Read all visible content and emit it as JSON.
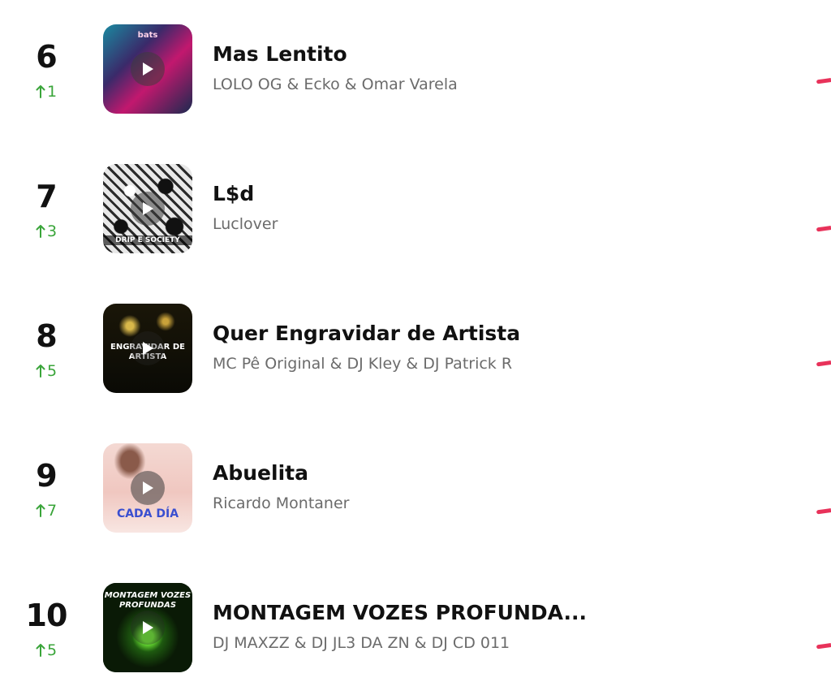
{
  "colors": {
    "rank_up": "#3aa53a",
    "title": "#111111",
    "artist": "#6b6b6b",
    "trend_line": "#e8325a"
  },
  "icons": {
    "rank_change": "arrow-up-icon",
    "play": "play-icon"
  },
  "tracks": [
    {
      "rank": "6",
      "change": "1",
      "title": "Mas Lentito",
      "artist": "LOLO OG & Ecko & Omar Varela",
      "cover_text": "bats"
    },
    {
      "rank": "7",
      "change": "3",
      "title": "L$d",
      "artist": "Luclover",
      "cover_text": "DRIP E SOCIETY"
    },
    {
      "rank": "8",
      "change": "5",
      "title": "Quer Engravidar de Artista",
      "artist": "MC Pê Original & DJ Kley & DJ Patrick R",
      "cover_text": "ENGRAVIDAR DE ARTISTA"
    },
    {
      "rank": "9",
      "change": "7",
      "title": "Abuelita",
      "artist": "Ricardo Montaner",
      "cover_text": "CADA DÍA"
    },
    {
      "rank": "10",
      "change": "5",
      "title": "MONTAGEM VOZES PROFUNDA...",
      "artist": "DJ MAXZZ & DJ JL3 DA ZN & DJ CD 011",
      "cover_text": "MONTAGEM VOZES PROFUNDAS"
    }
  ]
}
